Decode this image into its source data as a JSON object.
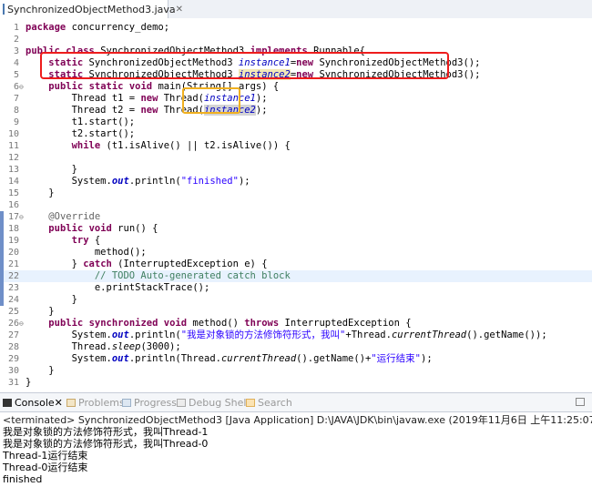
{
  "editor_tab": {
    "title": "SynchronizedObjectMethod3.java",
    "close": "✕"
  },
  "code_lines": [
    {
      "n": "1"
    },
    {
      "n": "2"
    },
    {
      "n": "3"
    },
    {
      "n": "4"
    },
    {
      "n": "5"
    },
    {
      "n": "6"
    },
    {
      "n": "7"
    },
    {
      "n": "8"
    },
    {
      "n": "9"
    },
    {
      "n": "10"
    },
    {
      "n": "11"
    },
    {
      "n": "12"
    },
    {
      "n": "13"
    },
    {
      "n": "14"
    },
    {
      "n": "15"
    },
    {
      "n": "16"
    },
    {
      "n": "17"
    },
    {
      "n": "18"
    },
    {
      "n": "19"
    },
    {
      "n": "20"
    },
    {
      "n": "21"
    },
    {
      "n": "22"
    },
    {
      "n": "23"
    },
    {
      "n": "24"
    },
    {
      "n": "25"
    },
    {
      "n": "26"
    },
    {
      "n": "27"
    },
    {
      "n": "28"
    },
    {
      "n": "29"
    },
    {
      "n": "30"
    },
    {
      "n": "31"
    }
  ],
  "tokens": {
    "package": "package",
    "pkg_name": " concurrency_demo;",
    "public": "public",
    "class": "class",
    "class_name": " SynchronizedObjectMethod3 ",
    "implements": "implements",
    "runnable": " Runnable{",
    "static": "static",
    "type": " SynchronizedObjectMethod3 ",
    "instance1": "instance1",
    "instance2": "instance2",
    "eq": "=",
    "new": "new",
    "ctor": " SynchronizedObjectMethod3();",
    "void": "void",
    "main_sig": " main(String[] args) {",
    "thread_t1": "Thread t1 = ",
    "thread_t2": "Thread t2 = ",
    "thread_ctor": " Thread(",
    "close_paren": ");",
    "t1_start": "t1.start();",
    "t2_start": "t2.start();",
    "while": "while",
    "while_cond": " (t1.isAlive() || t2.isAlive()) {",
    "rbrace": "}",
    "system": "System.",
    "out": "out",
    "println_open": ".println(",
    "finished_str": "\"finished\"",
    "override": "@Override",
    "run_sig": " run() {",
    "try": "try",
    "lbrace": " {",
    "method_call": "method();",
    "catch_open": "} ",
    "catch": "catch",
    "catch_sig": " (InterruptedException e) {",
    "todo": "// TODO Auto-generated catch block",
    "print_trace": "e.printStackTrace();",
    "synchronized": "synchronized",
    "method_sig": " method() ",
    "throws": "throws",
    "throws_type": " InterruptedException {",
    "str_lock": "\"我是对象锁的方法修饰符形式，我叫\"",
    "plus_thread": "+Thread.",
    "current_thread": "currentThread",
    "get_name": "().getName());",
    "thread_dot": "Thread.",
    "sleep": "sleep",
    "sleep_arg": "(3000);",
    "println_thread": ".println(Thread.",
    "get_name_plus": "().getName()+",
    "str_end": "\"运行结束\"",
    "end_paren": ");"
  },
  "console_tabs": [
    {
      "label": "Console",
      "suffix": " ✕"
    },
    {
      "label": "Problems"
    },
    {
      "label": "Progress"
    },
    {
      "label": "Debug Shell"
    },
    {
      "label": "Search"
    }
  ],
  "console": {
    "header": "<terminated> SynchronizedObjectMethod3 [Java Application] D:\\JAVA\\JDK\\bin\\javaw.exe (2019年11月6日 上午11:25:07)",
    "lines": [
      "我是对象锁的方法修饰符形式，我叫Thread-1",
      "我是对象锁的方法修饰符形式，我叫Thread-0",
      "Thread-1运行结束",
      "Thread-0运行结束",
      "finished"
    ]
  },
  "colors": {
    "keyword": "#7f0055",
    "string": "#2a00ff",
    "comment": "#3f7f5f",
    "field": "#0000c0",
    "red_box": "#ee1c1c",
    "yellow_box": "#f0b020"
  }
}
